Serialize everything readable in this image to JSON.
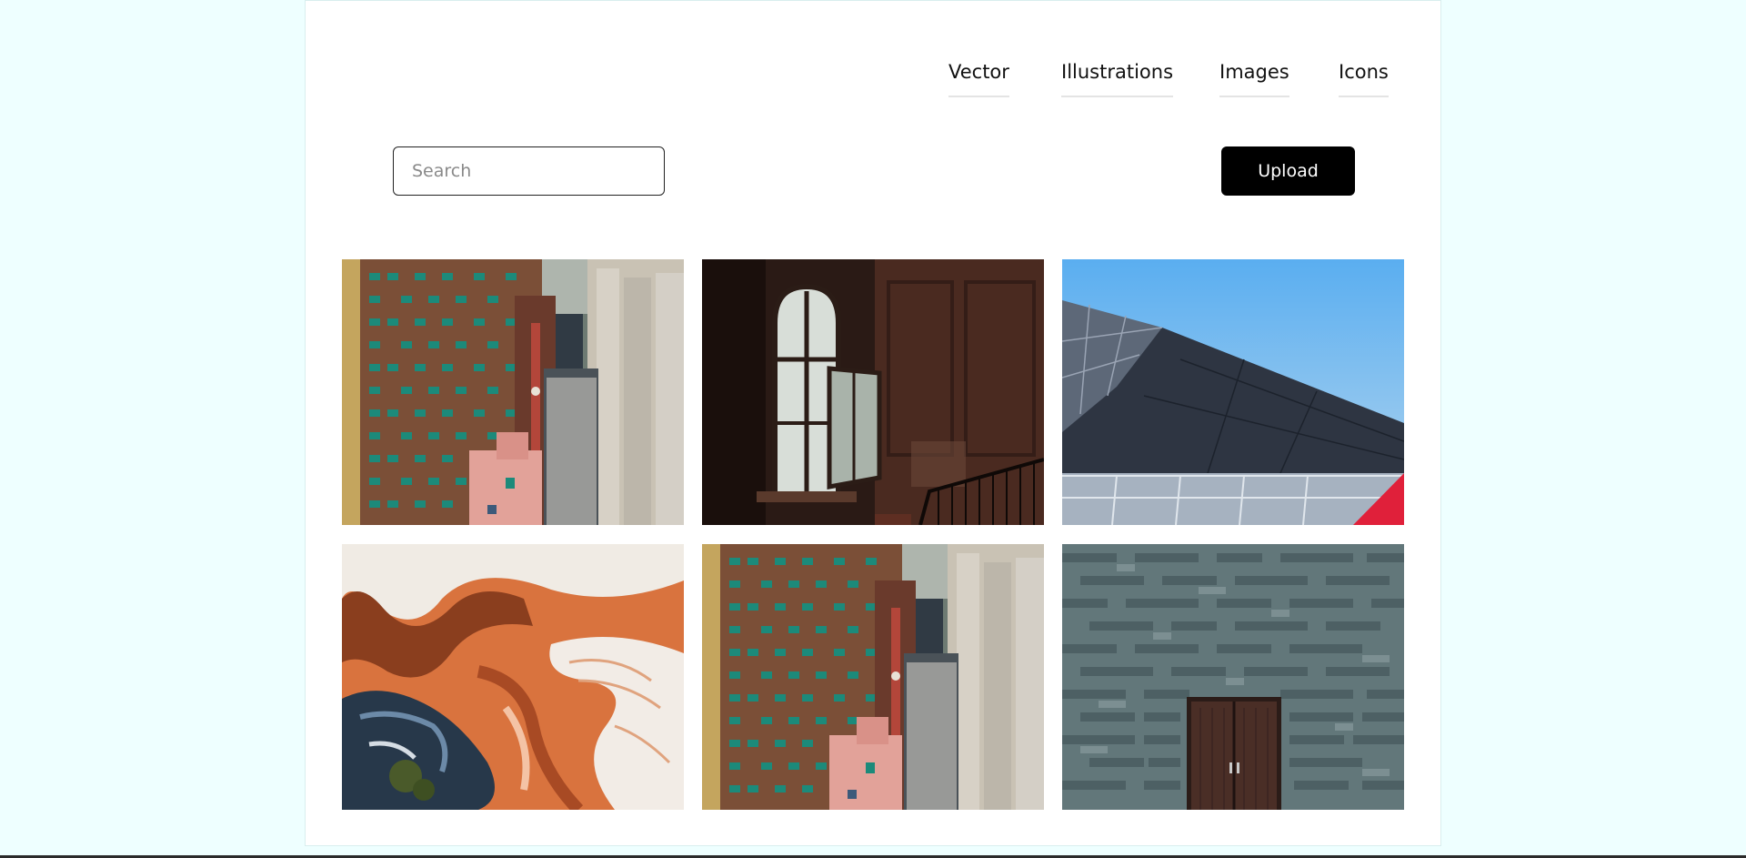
{
  "nav": {
    "items": [
      {
        "label": "Vector"
      },
      {
        "label": "Illustrations"
      },
      {
        "label": "Images"
      },
      {
        "label": "Icons"
      }
    ]
  },
  "search": {
    "placeholder": "Search",
    "value": ""
  },
  "upload": {
    "label": "Upload"
  },
  "gallery": {
    "images": [
      {
        "subject": "apartment-buildings-photo"
      },
      {
        "subject": "arched-window-interior-photo"
      },
      {
        "subject": "glass-roof-sky-photo"
      },
      {
        "subject": "aerial-sand-abstract-photo"
      },
      {
        "subject": "apartment-buildings-photo"
      },
      {
        "subject": "stone-wall-door-photo"
      }
    ]
  },
  "colors": {
    "background": "#eeffff",
    "card": "#ffffff",
    "button": "#000000",
    "button_text": "#ffffff"
  }
}
